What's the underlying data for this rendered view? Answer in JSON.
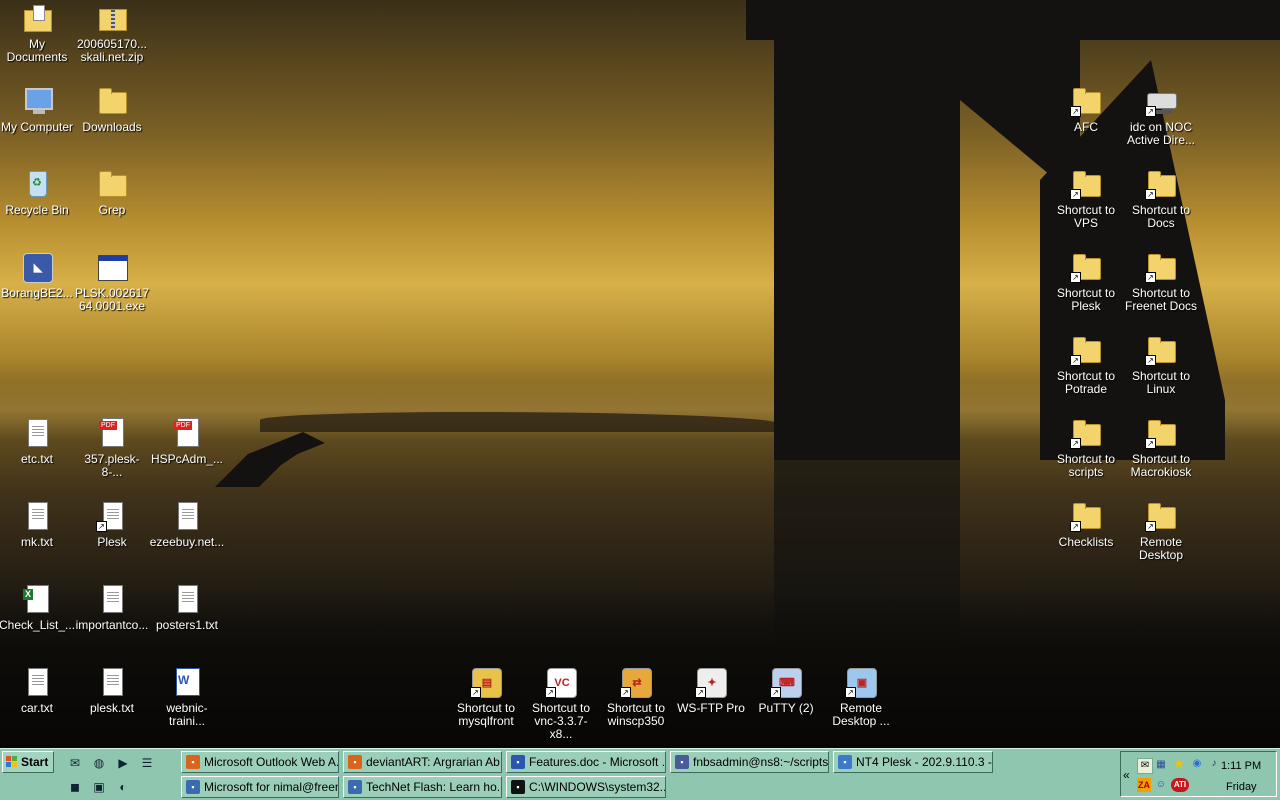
{
  "desktop": {
    "left_icons": [
      {
        "name": "my-documents",
        "label": "My Documents",
        "type": "mydocs"
      },
      {
        "name": "skali-zip",
        "label": "200605170...\nskali.net.zip",
        "type": "zip"
      },
      {
        "name": "my-computer",
        "label": "My Computer",
        "type": "monitor"
      },
      {
        "name": "downloads",
        "label": "Downloads",
        "type": "folder"
      },
      {
        "name": "recycle-bin",
        "label": "Recycle Bin",
        "type": "bin"
      },
      {
        "name": "grep",
        "label": "Grep",
        "type": "folder"
      },
      {
        "name": "borangbe2",
        "label": "BorangBE2...",
        "type": "app"
      },
      {
        "name": "plsk-exe",
        "label": "PLSK.002617\n64.0001.exe",
        "type": "exe"
      },
      {
        "name": "etc-txt",
        "label": "etc.txt",
        "type": "doc"
      },
      {
        "name": "plesk-357-pdf",
        "label": "357.plesk-8-...",
        "type": "pdf"
      },
      {
        "name": "hspcadm-pdf",
        "label": "HSPcAdm_...",
        "type": "pdf"
      },
      {
        "name": "mk-txt",
        "label": "mk.txt",
        "type": "doc"
      },
      {
        "name": "plesk-shortcut",
        "label": "Plesk",
        "type": "doc"
      },
      {
        "name": "ezeebuy",
        "label": "ezeebuy.net...",
        "type": "doc"
      },
      {
        "name": "check-list",
        "label": "Check_List_...",
        "type": "xls"
      },
      {
        "name": "importantco",
        "label": "importantco...",
        "type": "doc"
      },
      {
        "name": "posters1-txt",
        "label": "posters1.txt",
        "type": "doc"
      },
      {
        "name": "car-txt",
        "label": "car.txt",
        "type": "doc"
      },
      {
        "name": "plesk-txt",
        "label": "plesk.txt",
        "type": "doc"
      },
      {
        "name": "webnic-training",
        "label": "webnic-traini...",
        "type": "word"
      }
    ],
    "right_icons": [
      {
        "name": "afc",
        "label": "AFC",
        "type": "folder"
      },
      {
        "name": "idc-noc",
        "label": "idc on NOC\nActive Dire...",
        "type": "drive"
      },
      {
        "name": "shortcut-vps",
        "label": "Shortcut to\nVPS",
        "type": "folder"
      },
      {
        "name": "shortcut-docs",
        "label": "Shortcut to\nDocs",
        "type": "folder"
      },
      {
        "name": "shortcut-plesk",
        "label": "Shortcut to\nPlesk",
        "type": "folder"
      },
      {
        "name": "shortcut-freenet-docs",
        "label": "Shortcut to\nFreenet Docs",
        "type": "folder"
      },
      {
        "name": "shortcut-potrade",
        "label": "Shortcut to\nPotrade",
        "type": "folder"
      },
      {
        "name": "shortcut-linux",
        "label": "Shortcut to\nLinux",
        "type": "folder"
      },
      {
        "name": "shortcut-scripts",
        "label": "Shortcut to\nscripts",
        "type": "folder"
      },
      {
        "name": "shortcut-macrokiosk",
        "label": "Shortcut to\nMacrokiosk",
        "type": "folder"
      },
      {
        "name": "checklists",
        "label": "Checklists",
        "type": "folder"
      },
      {
        "name": "remote-desktop-folder",
        "label": "Remote\nDesktop",
        "type": "folder"
      }
    ],
    "bottom_icons": [
      {
        "name": "shortcut-mysqlfront",
        "label": "Shortcut to\nmysqlfront",
        "glyph": "▤",
        "color": "#e7c34a"
      },
      {
        "name": "shortcut-vnc",
        "label": "Shortcut to\nvnc-3.3.7-x8...",
        "glyph": "VC",
        "color": "#ffffff"
      },
      {
        "name": "shortcut-winscp",
        "label": "Shortcut to\nwinscp350",
        "glyph": "⇄",
        "color": "#e6a83a"
      },
      {
        "name": "ws-ftp-pro",
        "label": "WS-FTP Pro",
        "glyph": "✦",
        "color": "#eeeeee"
      },
      {
        "name": "putty",
        "label": "PuTTY (2)",
        "glyph": "⌨",
        "color": "#bcd0f0"
      },
      {
        "name": "remote-desktop",
        "label": "Remote\nDesktop ...",
        "glyph": "▣",
        "color": "#9cc8f0"
      }
    ]
  },
  "taskbar": {
    "start_label": "Start",
    "quick_launch": [
      "outlook-icon",
      "firefox-icon",
      "media-player-icon",
      "network-icon",
      "green-app-icon",
      "console-icon",
      "browser-icon"
    ],
    "tasks_row1": [
      {
        "name": "task-outlook-web",
        "label": "Microsoft Outlook Web A...",
        "icon_color": "#d9641c"
      },
      {
        "name": "task-deviantart",
        "label": "deviantART: Argrarian Ab...",
        "icon_color": "#d9641c"
      },
      {
        "name": "task-features-doc",
        "label": "Features.doc - Microsoft ...",
        "icon_color": "#2c55b0"
      },
      {
        "name": "task-fnbsadmin",
        "label": "fnbsadmin@ns8:~/scripts",
        "icon_color": "#4a5a9a"
      },
      {
        "name": "task-nt4-plesk",
        "label": "NT4 Plesk - 202.9.110.3 -...",
        "icon_color": "#3a7ac8"
      }
    ],
    "tasks_row2": [
      {
        "name": "task-microsoft-nimal",
        "label": "Microsoft for nimal@freen...",
        "icon_color": "#3a6ab0"
      },
      {
        "name": "task-technet",
        "label": "TechNet Flash: Learn ho...",
        "icon_color": "#3a6ab0"
      },
      {
        "name": "task-cmd",
        "label": "C:\\WINDOWS\\system32...",
        "icon_color": "#111111"
      }
    ],
    "tray": {
      "clock": "1:11 PM",
      "day": "Friday",
      "expand": "«",
      "za_label": "ZA",
      "ati_label": "ATI"
    }
  }
}
